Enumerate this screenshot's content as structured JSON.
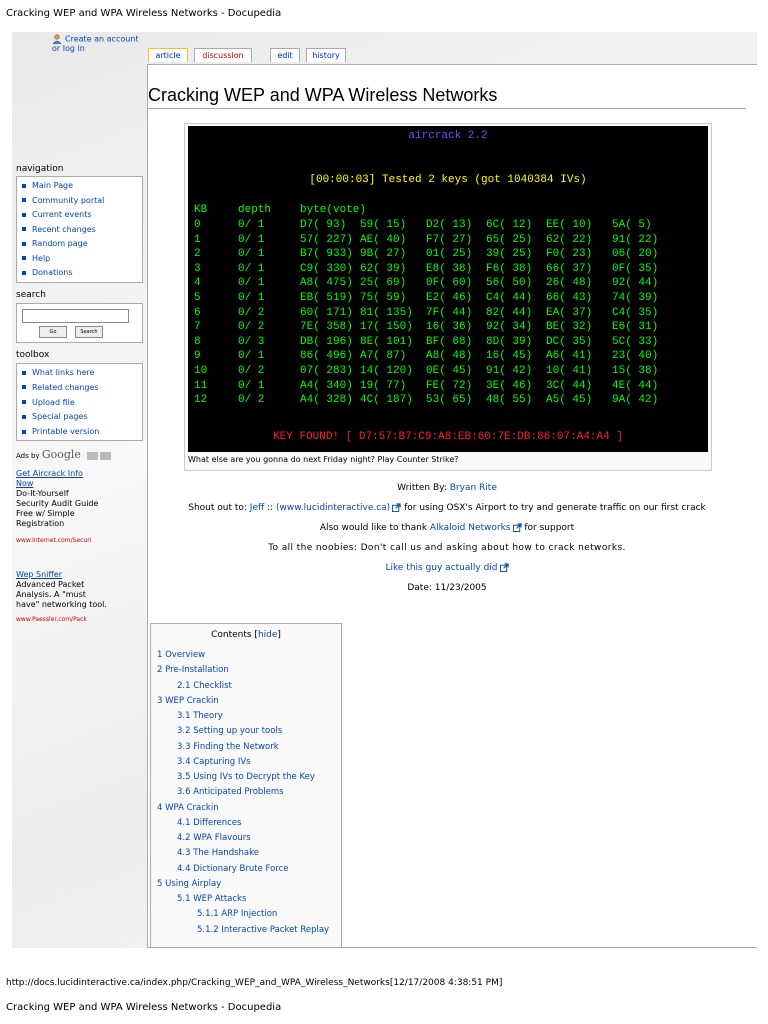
{
  "print_header": "Cracking WEP and WPA Wireless Networks - Docupedia",
  "print_footer_url": "http://docs.lucidinteractive.ca/index.php/Cracking_WEP_and_WPA_Wireless_Networks[12/17/2008 4:38:51 PM]",
  "print_footer_title": "Cracking WEP and WPA Wireless Networks - Docupedia",
  "personal": {
    "login": "Create an account or log in"
  },
  "tabs": [
    {
      "label": "article"
    },
    {
      "label": "discussion"
    },
    {
      "label": "edit"
    },
    {
      "label": "history"
    }
  ],
  "page_title": "Cracking WEP and WPA Wireless Networks",
  "terminal": {
    "title": "aircrack 2.2",
    "tested": "[00:00:03] Tested 2 keys (got 1040384 IVs)",
    "headers": [
      "KB",
      "depth",
      "byte(vote)"
    ],
    "rows": [
      [
        "0",
        "0/ 1",
        "D7( 93)",
        "59( 15)",
        "D2( 13)",
        "6C( 12)",
        "EE( 10)",
        "5A( 5)"
      ],
      [
        "1",
        "0/ 1",
        "57( 227)",
        "AE( 40)",
        "F7( 27)",
        "65( 25)",
        "62( 22)",
        "91( 22)"
      ],
      [
        "2",
        "0/ 1",
        "B7( 933)",
        "9B( 27)",
        "01( 25)",
        "39( 25)",
        "F0( 23)",
        "06( 20)"
      ],
      [
        "3",
        "0/ 1",
        "C9( 330)",
        "62( 39)",
        "E8( 38)",
        "F6( 38)",
        "66( 37)",
        "0F( 35)"
      ],
      [
        "4",
        "0/ 1",
        "A8( 475)",
        "25( 69)",
        "0F( 60)",
        "56( 50)",
        "26( 48)",
        "92( 44)"
      ],
      [
        "5",
        "0/ 1",
        "EB( 519)",
        "75( 59)",
        "E2( 46)",
        "C4( 44)",
        "66( 43)",
        "74( 39)"
      ],
      [
        "6",
        "0/ 2",
        "60( 171)",
        "81( 135)",
        "7F( 44)",
        "82( 44)",
        "EA( 37)",
        "C4( 35)"
      ],
      [
        "7",
        "0/ 2",
        "7E( 358)",
        "17( 150)",
        "16( 36)",
        "92( 34)",
        "BE( 32)",
        "E6( 31)"
      ],
      [
        "8",
        "0/ 3",
        "DB( 196)",
        "8E( 101)",
        "BF( 68)",
        "8D( 39)",
        "DC( 35)",
        "5C( 33)"
      ],
      [
        "9",
        "0/ 1",
        "86( 496)",
        "A7( 87)",
        "A8( 48)",
        "16( 45)",
        "A6( 41)",
        "23( 40)"
      ],
      [
        "10",
        "0/ 2",
        "07( 283)",
        "14( 120)",
        "0E( 45)",
        "91( 42)",
        "10( 41)",
        "15( 38)"
      ],
      [
        "11",
        "0/ 1",
        "A4( 340)",
        "19( 77)",
        "FE( 72)",
        "3E( 46)",
        "3C( 44)",
        "4E( 44)"
      ],
      [
        "12",
        "0/ 2",
        "A4( 328)",
        "4C( 187)",
        "53( 65)",
        "48( 55)",
        "A5( 45)",
        "9A( 42)"
      ]
    ],
    "key_found": "KEY FOUND! [ D7:57:B7:C9:A8:EB:60:7E:DB:86:07:A4:A4 ]"
  },
  "caption": "What else are you gonna do next Friday night? Play Counter Strike?",
  "body": {
    "written_by": "Written By:",
    "author": "Bryan Rite",
    "shout_prefix": "Shout out to:",
    "shout_name": "Jeff",
    "shout_sep": "::",
    "shout_link": "(www.lucidinteractive.ca)",
    "shout_suffix": "for using OSX's Airport to try and generate traffic on our first crack",
    "thanks_prefix": "Also would like to thank",
    "thanks_link": "Alkaloid Networks",
    "thanks_suffix": "for support",
    "noobies": "To all the noobies: Don't call us and asking about how to crack networks.",
    "like_this": "Like this guy actually did",
    "date": "Date: 11/23/2005"
  },
  "toc": {
    "title": "Contents",
    "hide": "hide",
    "items": [
      {
        "label": "1 Overview",
        "level": 1
      },
      {
        "label": "2 Pre-Installation",
        "level": 1
      },
      {
        "label": "2.1 Checklist",
        "level": 2
      },
      {
        "label": "3 WEP Crackin",
        "level": 1
      },
      {
        "label": "3.1 Theory",
        "level": 2
      },
      {
        "label": "3.2 Setting up your tools",
        "level": 2
      },
      {
        "label": "3.3 Finding the Network",
        "level": 2
      },
      {
        "label": "3.4 Capturing IVs",
        "level": 2
      },
      {
        "label": "3.5 Using IVs to Decrypt the Key",
        "level": 2
      },
      {
        "label": "3.6 Anticipated Problems",
        "level": 2
      },
      {
        "label": "4 WPA Crackin",
        "level": 1
      },
      {
        "label": "4.1 Differences",
        "level": 2
      },
      {
        "label": "4.2 WPA Flavours",
        "level": 2
      },
      {
        "label": "4.3 The Handshake",
        "level": 2
      },
      {
        "label": "4.4 Dictionary Brute Force",
        "level": 2
      },
      {
        "label": "5 Using Airplay",
        "level": 1
      },
      {
        "label": "5.1 WEP Attacks",
        "level": 2
      },
      {
        "label": "5.1.1 ARP Injection",
        "level": 3
      },
      {
        "label": "5.1.2 Interactive Packet Replay",
        "level": 3
      }
    ]
  },
  "sidebar": {
    "navigation_title": "navigation",
    "navigation": [
      "Main Page",
      "Community portal",
      "Current events",
      "Recent changes",
      "Random page",
      "Help",
      "Donations"
    ],
    "search_title": "search",
    "search_go": "Go",
    "search_search": "Search",
    "toolbox_title": "toolbox",
    "toolbox": [
      "What links here",
      "Related changes",
      "Upload file",
      "Special pages",
      "Printable version"
    ]
  },
  "ads": {
    "ads_by": "Ads by",
    "google": "Google",
    "ad1": {
      "title_1": "Get Aircrack Info",
      "title_2": "Now",
      "text": [
        "Do-It-Yourself",
        "Security Audit Guide",
        "Free w/ Simple",
        "Registration"
      ],
      "url": "www.Internet.com/Securi"
    },
    "ad2": {
      "title": "Wep Sniffer",
      "text": [
        "Advanced Packet",
        "Analysis. A \"must",
        "have\" networking tool."
      ],
      "url": "www.Paessler.com/Pack"
    }
  },
  "colors": {
    "link": "#0645ad",
    "new_link": "#ba0000",
    "terminal_bg": "#000000",
    "terminal_text": "#00ff00",
    "terminal_title": "#5a5aff",
    "terminal_tested": "#ffff00",
    "terminal_key": "#ff2020"
  }
}
